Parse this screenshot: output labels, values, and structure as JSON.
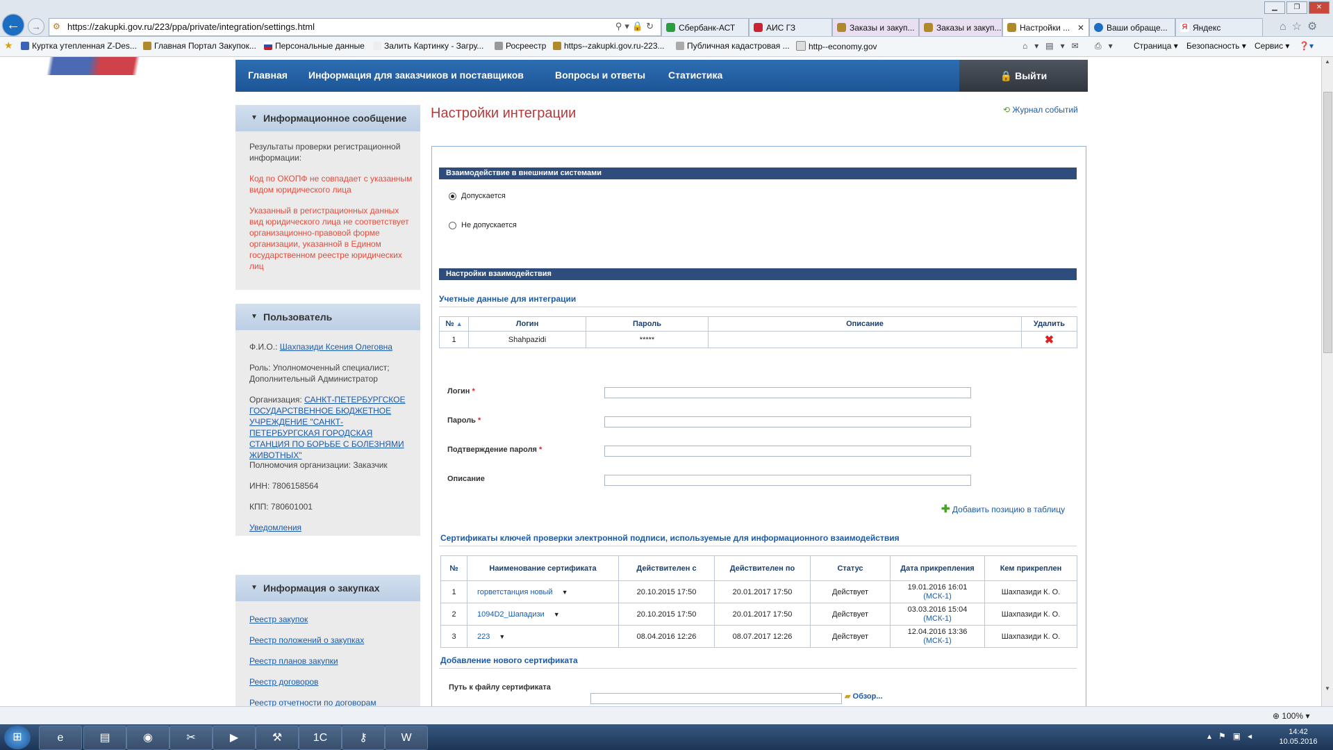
{
  "browser": {
    "url": "https://zakupki.gov.ru/223/ppa/private/integration/settings.html",
    "tabs": [
      "Сбербанк-АСТ",
      "АИС ГЗ",
      "Заказы и закуп...",
      "Заказы и закуп...",
      "Настройки ...",
      "Ваши обраще...",
      "Яндекс"
    ],
    "favorites": [
      "Куртка утепленная Z-Des...",
      "Главная Портал Закупок...",
      "Персональные данные",
      "Залить Картинку - Загру...",
      "Росреестр",
      "https--zakupki.gov.ru-223...",
      "Публичная кадастровая ...",
      "http--economy.gov"
    ],
    "commands": [
      "Страница ▾",
      "Безопасность ▾",
      "Сервис ▾"
    ],
    "zoom": "100%"
  },
  "nav": {
    "items": [
      "Главная",
      "Информация для заказчиков и поставщиков",
      "Вопросы и ответы",
      "Статистика"
    ],
    "logout": "Выйти"
  },
  "sidebar": {
    "info": {
      "title": "Информационное сообщение",
      "lead": "Результаты проверки регистрационной информации:",
      "err1": "Код по ОКОПФ не совпадает с указанным видом юридического лица",
      "err2": "Указанный в регистрационных данных вид юридического лица не соответствует организационно-правовой форме организации, указанной в Едином государственном реестре юридических лиц"
    },
    "user": {
      "title": "Пользователь",
      "fio_label": "Ф.И.О.:",
      "fio": "Шахпазиди Ксения Олеговна",
      "role": "Роль: Уполномоченный специалист; Дополнительный Администратор",
      "org_label": "Организация:",
      "org": "САНКТ-ПЕТЕРБУРГСКОЕ ГОСУДАРСТВЕННОЕ БЮДЖЕТНОЕ УЧРЕЖДЕНИЕ \"САНКТ-ПЕТЕРБУРГСКАЯ ГОРОДСКАЯ СТАНЦИЯ ПО БОРЬБЕ С БОЛЕЗНЯМИ ЖИВОТНЫХ\"",
      "powers": "Полномочия организации: Заказчик",
      "inn": "ИНН: 7806158564",
      "kpp": "КПП: 780601001",
      "notif": "Уведомления"
    },
    "purchases": {
      "title": "Информация о закупках",
      "links": [
        "Реестр закупок",
        "Реестр положений о закупках",
        "Реестр планов закупки",
        "Реестр договоров",
        "Реестр отчетности по договорам"
      ]
    }
  },
  "main": {
    "title": "Настройки интеграции",
    "journal": "Журнал событий",
    "sec1": "Взаимодействие в внешними системами",
    "radio_allow": "Допускается",
    "radio_deny": "Не допускается",
    "sec2": "Настройки взаимодействия",
    "cred_head": "Учетные данные для интеграции",
    "cred_cols": [
      "№",
      "Логин",
      "Пароль",
      "Описание",
      "Удалить"
    ],
    "cred_rows": [
      {
        "n": "1",
        "login": "Shahpazidi",
        "pass": "*****",
        "desc": ""
      }
    ],
    "form": {
      "login": "Логин",
      "pass": "Пароль",
      "confirm": "Подтверждение пароля",
      "desc": "Описание",
      "req": "*"
    },
    "add_pos": "Добавить позицию в таблицу",
    "cert_head": "Сертификаты ключей проверки электронной подписи, используемые для информационного взаимодействия",
    "cert_cols": [
      "№",
      "Наименование сертификата",
      "Действителен с",
      "Действителен по",
      "Статус",
      "Дата прикрепления",
      "Кем прикреплен"
    ],
    "cert_rows": [
      {
        "n": "1",
        "name": "горветстанция новый",
        "from": "20.10.2015 17:50",
        "to": "20.01.2017 17:50",
        "status": "Действует",
        "date": "19.01.2016 16:01",
        "tz": "(МСК-1)",
        "by": "Шахпазиди К. О."
      },
      {
        "n": "2",
        "name": "1094D2_Шападизи",
        "from": "20.10.2015 17:50",
        "to": "20.01.2017 17:50",
        "status": "Действует",
        "date": "03.03.2016 15:04",
        "tz": "(МСК-1)",
        "by": "Шахпазиди К. О."
      },
      {
        "n": "3",
        "name": "223",
        "from": "08.04.2016 12:26",
        "to": "08.07.2017 12:26",
        "status": "Действует",
        "date": "12.04.2016 13:36",
        "tz": "(МСК-1)",
        "by": "Шахпазиди К. О."
      }
    ],
    "add_cert": "Добавление нового сертификата",
    "path_label": "Путь к файлу сертификата",
    "browse": "Обзор..."
  },
  "taskbar": {
    "time": "14:42",
    "date": "10.05.2016"
  }
}
